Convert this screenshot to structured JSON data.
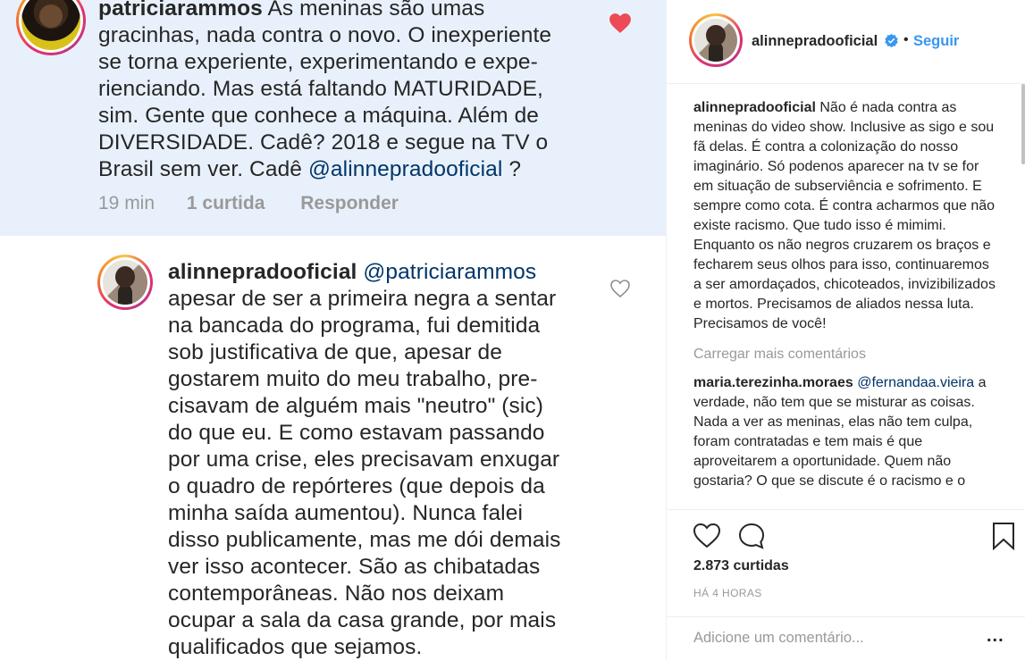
{
  "comment1": {
    "username": "patriciarammos",
    "lines": [
      "As meninas são umas",
      "gracinhas, nada contra o novo. O inexperiente",
      "se torna experiente, experimentando e  expe-",
      "rienciando. Mas está faltando MATURIDADE,",
      "sim. Gente que conhece a máquina. Além de",
      "DIVERSIDADE. Cadê? 2018 e segue na TV o"
    ],
    "last_line_prefix": "Brasil sem ver. Cadê",
    "mention": "@alinnepradooficial",
    "last_line_suffix": " ?",
    "time": "19 min",
    "likes": "1 curtida",
    "reply": "Responder",
    "liked": true
  },
  "comment2": {
    "username": "alinnepradooficial",
    "mention": "@patriciarammos",
    "lines": [
      "apesar de ser a primeira negra a sentar",
      "na bancada do programa, fui demitida",
      "sob justificativa de que, apesar de",
      "gostarem muito do meu trabalho, pre-",
      "cisavam de alguém mais \"neutro\" (sic)",
      "do que eu.  E como estavam passando",
      "por uma crise, eles precisavam enxugar",
      "o quadro de repórteres (que depois da",
      "minha saída aumentou).  Nunca falei",
      "disso publicamente, mas me dói demais",
      "ver isso acontecer.  São as chibatadas",
      "contemporâneas.  Não nos deixam",
      "ocupar a sala da casa grande, por mais",
      "qualificados que sejamos."
    ]
  },
  "post": {
    "username": "alinnepradooficial",
    "separator": "•",
    "follow_label": "Seguir",
    "caption_user": "alinnepradooficial",
    "caption": "Não é nada contra as meninas do video show. Inclusive as sigo e sou fã delas. É contra a colonização do nosso imaginário. Só podenos aparecer na tv se for em situação de subserviência e sofrimento. E sempre como cota. É contra acharmos que não existe racismo. Que tudo isso é mimimi. Enquanto os não negros cruzarem os braços e fecharem seus olhos para isso, continuaremos a ser amordaçados, chicoteados, invizibilizados e mortos. Precisamos de aliados nessa luta. Precisamos de você!",
    "load_more": "Carregar mais comentários",
    "comment_user": "maria.terezinha.moraes",
    "comment_mention": "@fernandaa.vieira",
    "comment_text": "a verdade, não tem que se misturar as coisas. Nada a ver as meninas, elas não tem culpa, foram contratadas e tem mais é que aproveitarem a oportunidade. Quem não gostaria? O que se discute é o racismo e o",
    "likes": "2.873 curtidas",
    "time": "HÁ 4 HORAS",
    "add_comment_placeholder": "Adicione um comentário...",
    "more_label": "..."
  },
  "icons": [
    "heart-filled-icon",
    "heart-outline-icon",
    "verified-badge-icon",
    "comment-icon",
    "bookmark-icon",
    "more-options-icon"
  ],
  "colors": {
    "highlight_bg": "#e8f1fb",
    "like_red": "#ed4956",
    "link_blue": "#3897f0",
    "mention": "#003569",
    "muted": "#999999"
  }
}
